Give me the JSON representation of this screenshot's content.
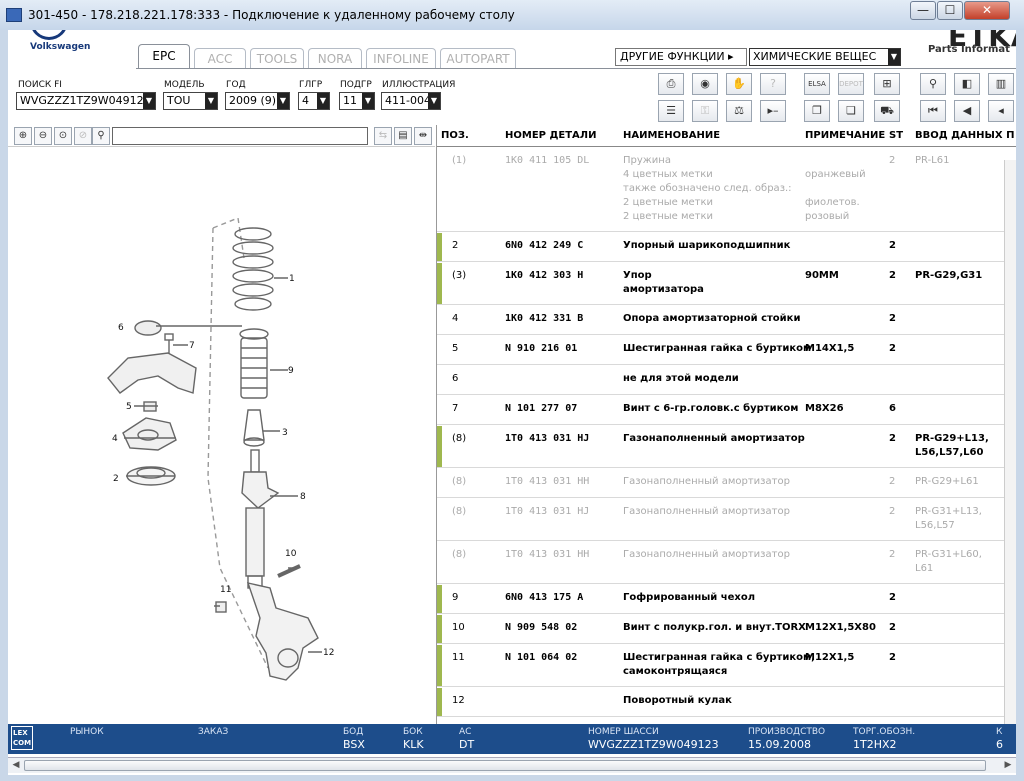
{
  "window": {
    "title": "301-450 - 178.218.221.178:333 - Подключение к удаленному рабочему столу",
    "min_label": "—",
    "max_label": "☐",
    "close_label": "✕"
  },
  "brand": {
    "vw": "Volkswagen",
    "etka": "ETKA",
    "etka_sub": "Parts Informat"
  },
  "tabs": [
    "EPC",
    "ACC",
    "TOOLS",
    "NORA",
    "INFOLINE",
    "AUTOPART"
  ],
  "other_functions": "ДРУГИЕ ФУНКЦИИ ▸",
  "chem_select": "ХИМИЧЕСКИЕ ВЕЩЕС",
  "selectors": {
    "fi": {
      "label": "ПОИСК FI",
      "value": "WVGZZZ1TZ9W04912"
    },
    "model": {
      "label": "МОДЕЛЬ",
      "value": "TOU"
    },
    "year": {
      "label": "ГОД",
      "value": "2009 (9)"
    },
    "glgr": {
      "label": "ГЛГР",
      "value": "4"
    },
    "podgr": {
      "label": "ПОДГР",
      "value": "11"
    },
    "illustration": {
      "label": "ИЛЛЮСТРАЦИЯ",
      "value": "411-004"
    }
  },
  "toolbar_icons": {
    "row1": [
      "printer-icon",
      "disc-icon",
      "lookup-icon",
      "notes-icon",
      "elsa-icon",
      "depot-icon",
      "cart-add-icon",
      "pin-icon",
      "back-page-icon",
      "book-icon"
    ],
    "row2": [
      "list-icon",
      "key-icon",
      "balance-icon",
      "next-minus-icon",
      "copy-icon",
      "copy2-icon",
      "cart-icon",
      "first-icon",
      "prev-icon",
      "prev2-icon"
    ],
    "elsa": "ELSA",
    "depot": "DEPOT"
  },
  "illustration_toolbar": [
    "zoom-in-icon",
    "zoom-out-icon",
    "zoom-fit-icon",
    "zoom-reset-icon",
    "magnifier-icon"
  ],
  "callouts": [
    "1",
    "2",
    "3",
    "4",
    "5",
    "6",
    "7",
    "8",
    "9",
    "10",
    "11",
    "12"
  ],
  "parts_table": {
    "headers": {
      "pos": "ПОЗ.",
      "part_number": "НОМЕР ДЕТАЛИ",
      "name": "НАИМЕНОВАНИЕ",
      "note": "ПРИМЕЧАНИЕ",
      "st": "ST",
      "input": "ВВОД ДАННЫХ П"
    },
    "rows": [
      {
        "pos": "(1)",
        "num": "1K0  411  105  DL",
        "name": [
          "Пружина",
          "4 цветных метки",
          "также обозначено след. образ.:",
          "2 цветные метки",
          "2 цветные метки"
        ],
        "note": [
          "",
          "оранжевый",
          "",
          "фиолетов.",
          "розовый"
        ],
        "st": "2",
        "input": [
          "PR-L61"
        ],
        "gray": true,
        "bar": false
      },
      {
        "pos": "2",
        "num": "6N0  412  249  C",
        "name": [
          "Упорный шарикоподшипник"
        ],
        "note": [
          ""
        ],
        "st": "2",
        "input": [
          ""
        ],
        "gray": false,
        "bar": true
      },
      {
        "pos": "(3)",
        "num": "1K0  412  303  H",
        "name": [
          "Упор",
          "амортизатора"
        ],
        "note": [
          "90MM"
        ],
        "st": "2",
        "input": [
          "PR-G29,G31"
        ],
        "gray": false,
        "bar": true
      },
      {
        "pos": "4",
        "num": "1K0  412  331  B",
        "name": [
          "Опора амортизаторной стойки"
        ],
        "note": [
          ""
        ],
        "st": "2",
        "input": [
          ""
        ],
        "gray": false,
        "bar": false
      },
      {
        "pos": "5",
        "num": "N     910  216  01",
        "name": [
          "Шестигранная гайка с буртиком"
        ],
        "note": [
          "M14X1,5"
        ],
        "st": "2",
        "input": [
          ""
        ],
        "gray": false,
        "bar": false
      },
      {
        "pos": "6",
        "num": "",
        "name": [
          "не для этой модели"
        ],
        "note": [
          ""
        ],
        "st": "",
        "input": [
          ""
        ],
        "gray": false,
        "bar": false
      },
      {
        "pos": "7",
        "num": "N     101  277  07",
        "name": [
          "Винт с 6-гр.головк.с буртиком"
        ],
        "note": [
          "M8X26"
        ],
        "st": "6",
        "input": [
          ""
        ],
        "gray": false,
        "bar": false
      },
      {
        "pos": "(8)",
        "num": "1T0  413  031  HJ",
        "name": [
          "Газонаполненный амортизатор"
        ],
        "note": [
          ""
        ],
        "st": "2",
        "input": [
          "PR-G29+L13,",
          "L56,L57,L60"
        ],
        "gray": false,
        "bar": true
      },
      {
        "pos": "(8)",
        "num": "1T0  413  031  HH",
        "name": [
          "Газонаполненный амортизатор"
        ],
        "note": [
          ""
        ],
        "st": "2",
        "input": [
          "PR-G29+L61"
        ],
        "gray": true,
        "bar": false
      },
      {
        "pos": "(8)",
        "num": "1T0  413  031  HJ",
        "name": [
          "Газонаполненный амортизатор"
        ],
        "note": [
          ""
        ],
        "st": "2",
        "input": [
          "PR-G31+L13,",
          "L56,L57"
        ],
        "gray": true,
        "bar": false
      },
      {
        "pos": "(8)",
        "num": "1T0  413  031  HH",
        "name": [
          "Газонаполненный амортизатор"
        ],
        "note": [
          ""
        ],
        "st": "2",
        "input": [
          "PR-G31+L60,",
          "L61"
        ],
        "gray": true,
        "bar": false
      },
      {
        "pos": "9",
        "num": "6N0  413  175  A",
        "name": [
          "Гофрированный чехол"
        ],
        "note": [
          ""
        ],
        "st": "2",
        "input": [
          ""
        ],
        "gray": false,
        "bar": true
      },
      {
        "pos": "10",
        "num": "N     909  548  02",
        "name": [
          "Винт с полукр.гол. и внут.TORX"
        ],
        "note": [
          "M12X1,5X80"
        ],
        "st": "2",
        "input": [
          ""
        ],
        "gray": false,
        "bar": true
      },
      {
        "pos": "11",
        "num": "N     101  064  02",
        "name": [
          "Шестигранная гайка с буртиком,",
          "самоконтрящаяся"
        ],
        "note": [
          "M12X1,5"
        ],
        "st": "2",
        "input": [
          ""
        ],
        "gray": false,
        "bar": true
      },
      {
        "pos": "12",
        "num": "",
        "name": [
          "Поворотный кулак"
        ],
        "note": [
          ""
        ],
        "st": "",
        "input": [
          ""
        ],
        "gray": false,
        "bar": true
      }
    ]
  },
  "status": {
    "lexcom": "LEX COM",
    "market": {
      "label": "РЫНОК",
      "value": ""
    },
    "order": {
      "label": "ЗАКАЗ",
      "value": ""
    },
    "bod": {
      "label": "БОД",
      "value": "BSX"
    },
    "bok": {
      "label": "БОК",
      "value": "KLK"
    },
    "ac": {
      "label": "АС",
      "value": "DT"
    },
    "vin": {
      "label": "НОМЕР ШАССИ",
      "value": "WVGZZZ1TZ9W049123"
    },
    "prod": {
      "label": "ПРОИЗВОДСТВО",
      "value": "15.09.2008"
    },
    "torg": {
      "label": "ТОРГ.ОБОЗН.",
      "value": "1T2HX2"
    },
    "k": {
      "label": "К",
      "value": "6"
    }
  }
}
